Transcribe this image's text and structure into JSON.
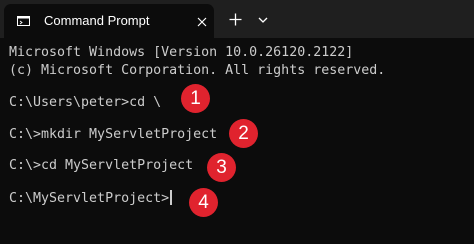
{
  "window": {
    "tab_title": "Command Prompt",
    "tab_icon": "terminal-icon",
    "close_icon": "close-icon",
    "new_tab_icon": "plus-icon",
    "dropdown_icon": "chevron-down-icon"
  },
  "terminal": {
    "lines": [
      "Microsoft Windows [Version 10.0.26120.2122]",
      "(c) Microsoft Corporation. All rights reserved.",
      "C:\\Users\\peter>cd \\",
      "C:\\>mkdir MyServletProject",
      "C:\\>cd MyServletProject",
      "C:\\MyServletProject>"
    ]
  },
  "badges": {
    "color": "#e0232e",
    "labels": [
      "1",
      "2",
      "3",
      "4"
    ]
  },
  "colors": {
    "background": "#0c0c0c",
    "tabbar": "#1f1f1f",
    "text": "#cccccc"
  }
}
